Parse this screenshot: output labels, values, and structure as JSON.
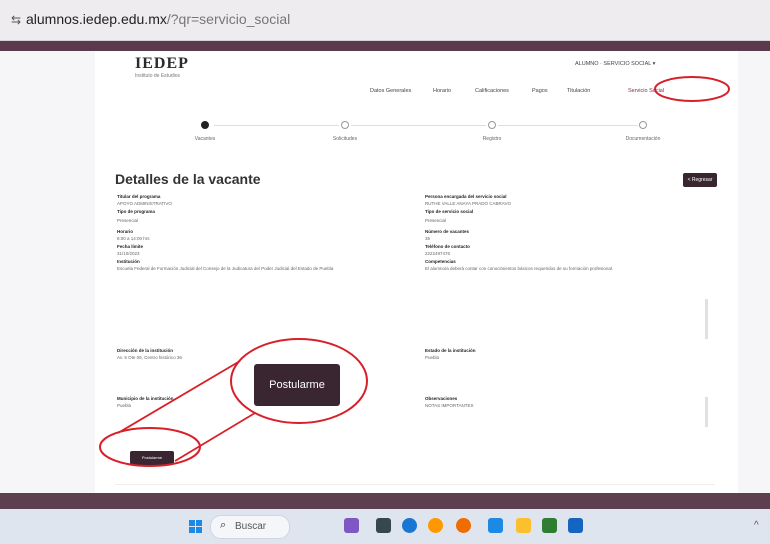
{
  "browser": {
    "url_host": "alumnos.iedep.edu.mx",
    "url_path": "/?qr=servicio_social"
  },
  "header": {
    "logo": "IEDEP",
    "logo_subtitle": "Instituto de Estudios",
    "user_menu": "ALUMNO · SERVICIO SOCIAL ▾",
    "nav": [
      "Datos Generales",
      "Horario",
      "Calificaciones",
      "Pagos",
      "Titulación",
      "Servicio Social"
    ]
  },
  "stepper": [
    "Vacantes",
    "Solicitudes",
    "Registro",
    "Documentación"
  ],
  "details": {
    "title": "Detalles de la vacante",
    "back_label": "< Regresar",
    "left": [
      {
        "label": "Titular del programa",
        "value": "APOYO ADMINISTRATIVO"
      },
      {
        "label": "Tipo de programa",
        "value": "Presencial"
      },
      {
        "label": "Horario",
        "value": "8:00 a 14:00 hrs"
      },
      {
        "label": "Fecha límite",
        "value": "31/10/2023"
      },
      {
        "label": "Institución",
        "value": "Escuela Federal de Formación Judicial del Consejo de la Judicatura del Poder Judicial del Estado de Puebla"
      },
      {
        "label": "Dirección de la institución",
        "value": "Av. 5 Ote 09, Centro histórico 36"
      },
      {
        "label": "Municipio de la institución",
        "value": "Puebla"
      }
    ],
    "right": [
      {
        "label": "Persona encargada del servicio social",
        "value": "RUTHE VALLE ANAYA PRADO CABRAVO"
      },
      {
        "label": "Tipo de servicio social",
        "value": "Presencial"
      },
      {
        "label": "Número de vacantes",
        "value": "35"
      },
      {
        "label": "Teléfono de contacto",
        "value": "2222497476"
      },
      {
        "label": "Competencias",
        "value": "El alumno/a deberá contar con conocimientos básicos requeridos de su formación profesional."
      },
      {
        "label": "Estado de la institución",
        "value": "Puebla"
      },
      {
        "label": "Observaciones",
        "value": "NOTAS IMPORTANTES"
      }
    ],
    "postular_small": "Postularme",
    "postular_big": "Postularme"
  },
  "taskbar": {
    "search_placeholder": "Buscar"
  }
}
